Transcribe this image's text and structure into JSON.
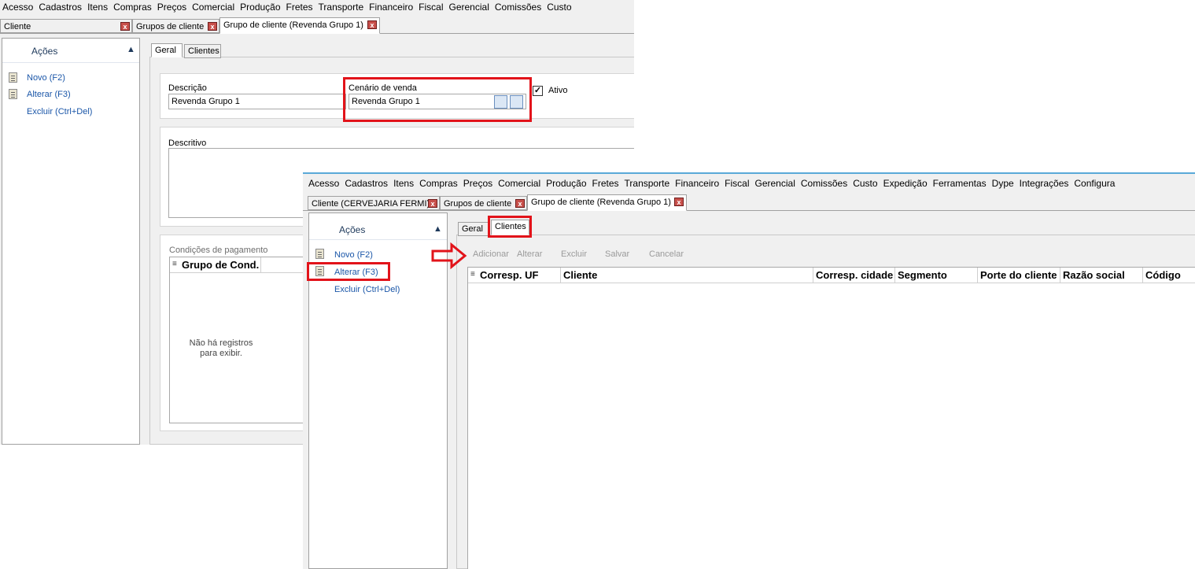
{
  "menu": [
    "Acesso",
    "Cadastros",
    "Itens",
    "Compras",
    "Preços",
    "Comercial",
    "Produção",
    "Fretes",
    "Transporte",
    "Financeiro",
    "Fiscal",
    "Gerencial",
    "Comissões",
    "Custo",
    "Expedição",
    "Ferramentas",
    "Dype",
    "Integrações",
    "Configura"
  ],
  "back": {
    "tabs": [
      {
        "label": "Cliente"
      },
      {
        "label": "Grupos de cliente"
      },
      {
        "label": "Grupo de cliente (Revenda Grupo 1)"
      }
    ],
    "close_glyph": "x",
    "acoes_title": "Ações",
    "actions": [
      {
        "label": "Novo (F2)"
      },
      {
        "label": "Alterar (F3)"
      },
      {
        "label": "Excluir (Ctrl+Del)"
      }
    ],
    "subtabs": [
      "Geral",
      "Clientes"
    ],
    "descricao_label": "Descrição",
    "descricao_value": "Revenda Grupo 1",
    "cenario_label": "Cenário de venda",
    "cenario_value": "Revenda Grupo 1",
    "ativo_label": "Ativo",
    "ativo_check": "✓",
    "descritivo_label": "Descritivo",
    "condicoes_label": "Condições de pagamento",
    "grid_header": "Grupo de Cond.",
    "empty_line1": "Não há registros",
    "empty_line2": "para exibir."
  },
  "front": {
    "tabs": [
      {
        "label": "Cliente (CERVEJARIA FERMI)"
      },
      {
        "label": "Grupos de cliente"
      },
      {
        "label": "Grupo de cliente (Revenda Grupo 1)"
      }
    ],
    "acoes_title": "Ações",
    "actions": [
      {
        "label": "Novo (F2)"
      },
      {
        "label": "Alterar (F3)"
      },
      {
        "label": "Excluir (Ctrl+Del)"
      }
    ],
    "subtabs": [
      "Geral",
      "Clientes"
    ],
    "toolbar": [
      "Adicionar",
      "Alterar",
      "Excluir",
      "Salvar",
      "Cancelar"
    ],
    "columns": [
      "Corresp. UF",
      "Cliente",
      "Corresp. cidade",
      "Segmento",
      "Porte do cliente",
      "Razão social",
      "Código"
    ]
  },
  "colors": {
    "highlight": "#e2131a",
    "link": "#1a56a8",
    "accent_line": "#5aa9d8"
  }
}
